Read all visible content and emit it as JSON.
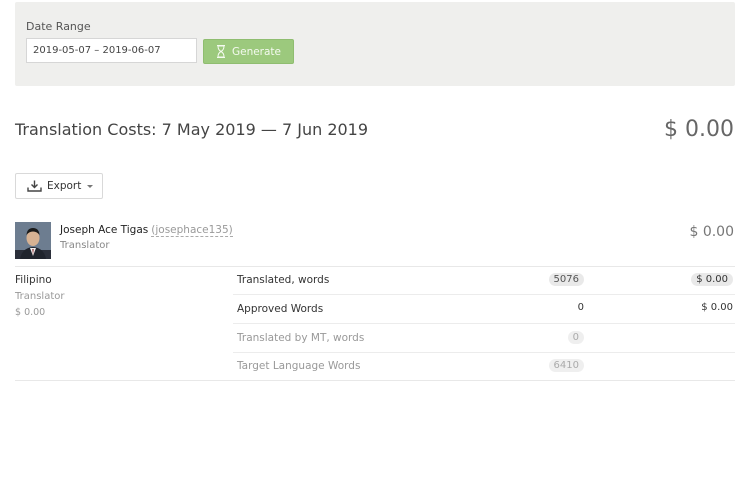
{
  "filter": {
    "date_range_label": "Date Range",
    "date_range_value": "2019-05-07 – 2019-06-07",
    "generate_label": "Generate"
  },
  "report": {
    "title": "Translation Costs: 7 May 2019 — 7 Jun 2019",
    "total": "$ 0.00",
    "export_label": "Export"
  },
  "user": {
    "name": "Joseph Ace Tigas",
    "handle": "(josephace135)",
    "role": "Translator",
    "amount": "$ 0.00"
  },
  "language": {
    "name": "Filipino",
    "role": "Translator",
    "amount": "$ 0.00"
  },
  "metrics": [
    {
      "label": "Translated, words",
      "value": "5076",
      "cost": "$ 0.00"
    },
    {
      "label": "Approved Words",
      "value": "0",
      "cost": "$ 0.00"
    },
    {
      "label": "Translated by MT, words",
      "value": "0",
      "cost": ""
    },
    {
      "label": "Target Language Words",
      "value": "6410",
      "cost": ""
    }
  ],
  "colors": {
    "generate_button": "#9cc97d",
    "panel_background": "#efefed"
  },
  "icons": {
    "generate": "hourglass-icon",
    "export": "download-tray-icon",
    "dropdown": "caret-down-icon"
  }
}
